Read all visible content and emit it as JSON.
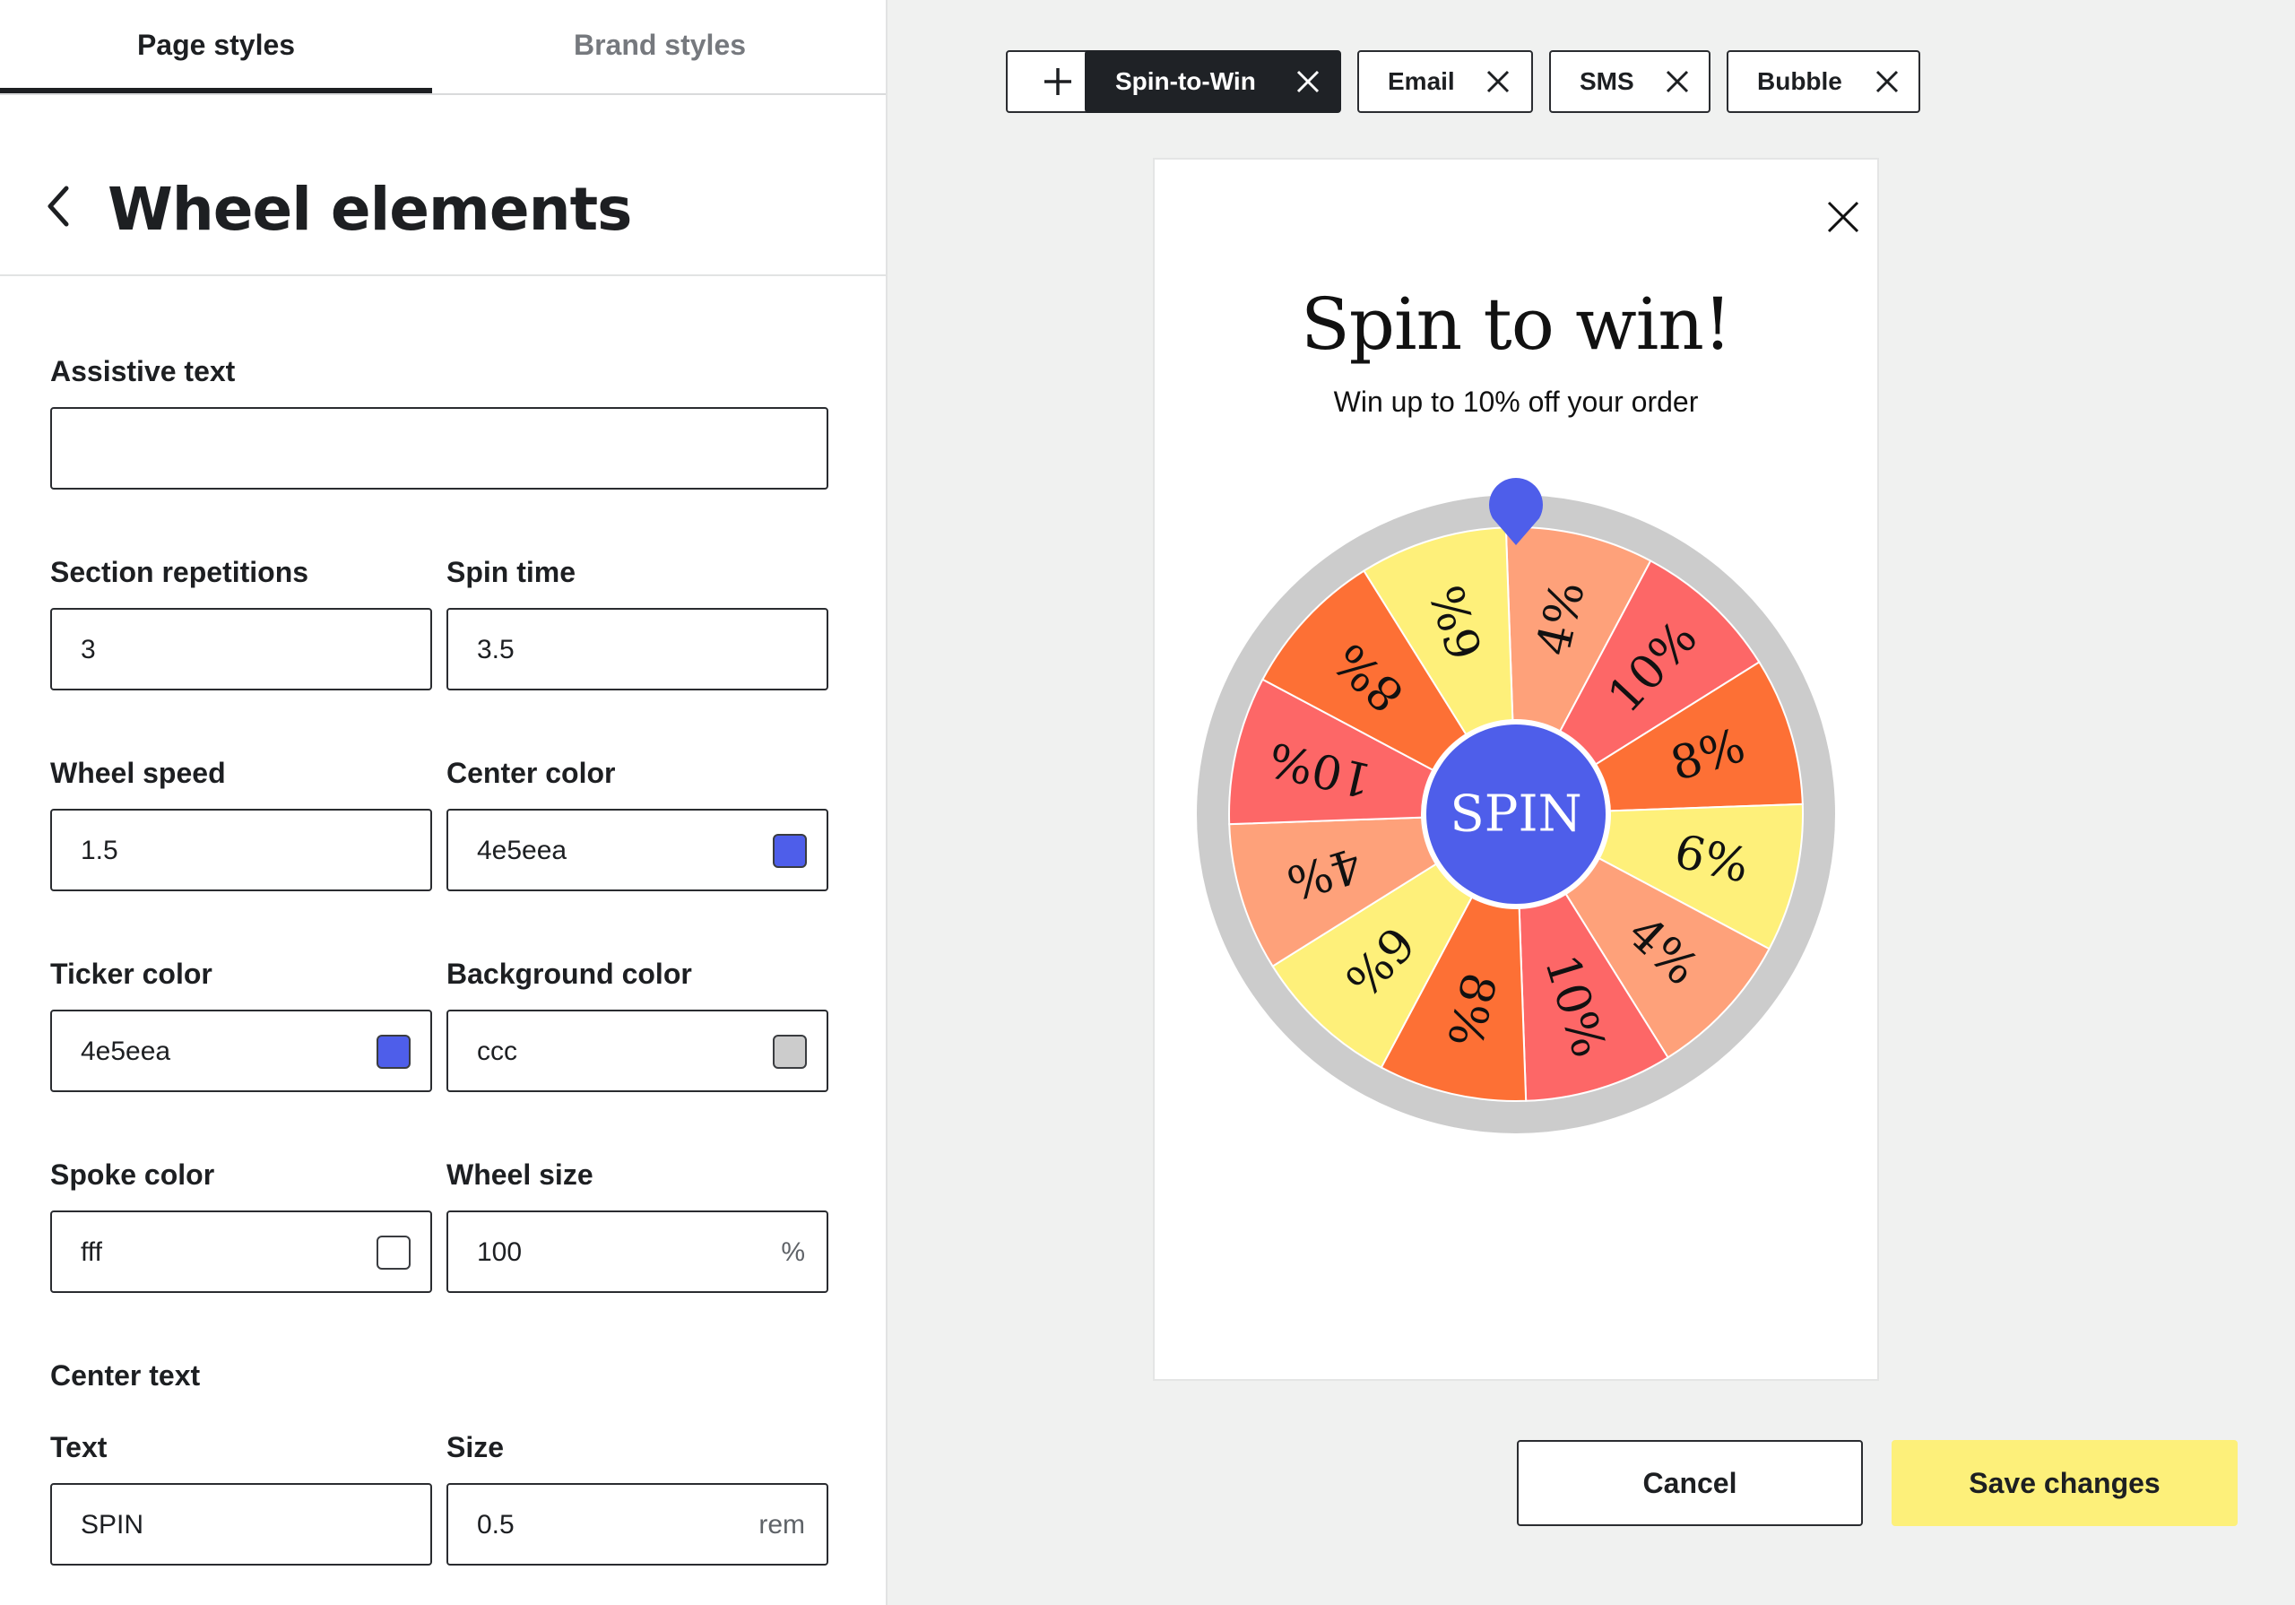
{
  "tabs": [
    {
      "label": "Page styles",
      "active": true
    },
    {
      "label": "Brand styles",
      "active": false
    }
  ],
  "panel": {
    "title": "Wheel elements"
  },
  "fields": {
    "assistive_text": {
      "label": "Assistive text",
      "value": ""
    },
    "section_repetitions": {
      "label": "Section repetitions",
      "value": "3"
    },
    "spin_time": {
      "label": "Spin time",
      "value": "3.5"
    },
    "wheel_speed": {
      "label": "Wheel speed",
      "value": "1.5"
    },
    "center_color": {
      "label": "Center color",
      "value": "4e5eea",
      "swatch": "#4e5eea"
    },
    "ticker_color": {
      "label": "Ticker color",
      "value": "4e5eea",
      "swatch": "#4e5eea"
    },
    "background_color": {
      "label": "Background color",
      "value": "ccc",
      "swatch": "#cccccc"
    },
    "spoke_color": {
      "label": "Spoke color",
      "value": "fff",
      "swatch": "#ffffff"
    },
    "wheel_size": {
      "label": "Wheel size",
      "value": "100",
      "unit": "%"
    },
    "center_text": {
      "section_label": "Center text",
      "text": {
        "label": "Text",
        "value": "SPIN"
      },
      "size": {
        "label": "Size",
        "value": "0.5",
        "unit": "rem"
      }
    }
  },
  "preview_tabs": [
    {
      "label": "Spin-to-Win",
      "active": true
    },
    {
      "label": "Email",
      "active": false
    },
    {
      "label": "SMS",
      "active": false
    },
    {
      "label": "Bubble",
      "active": false
    }
  ],
  "icons": {
    "add": "plus-icon",
    "close": "close-icon",
    "back": "chevron-left-icon",
    "ticker": "map-pin-icon"
  },
  "preview": {
    "title": "Spin to win!",
    "subtitle": "Win up to 10% off your order",
    "wheel": {
      "center_text": "SPIN",
      "center_color": "#4e5eea",
      "ticker_color": "#4e5eea",
      "rim_color": "#cccccc",
      "spoke_color": "#ffffff",
      "segments": [
        {
          "label": "4%",
          "color": "#fea17a"
        },
        {
          "label": "10%",
          "color": "#fd6767"
        },
        {
          "label": "8%",
          "color": "#fd7035"
        },
        {
          "label": "6%",
          "color": "#fef07a"
        },
        {
          "label": "4%",
          "color": "#fea17a"
        },
        {
          "label": "10%",
          "color": "#fd6767"
        },
        {
          "label": "8%",
          "color": "#fd7035"
        },
        {
          "label": "6%",
          "color": "#fef07a"
        },
        {
          "label": "4%",
          "color": "#fea17a"
        },
        {
          "label": "10%",
          "color": "#fd6767"
        },
        {
          "label": "8%",
          "color": "#fd7035"
        },
        {
          "label": "6%",
          "color": "#fef07a"
        }
      ]
    }
  },
  "actions": {
    "cancel": "Cancel",
    "save": "Save changes"
  }
}
